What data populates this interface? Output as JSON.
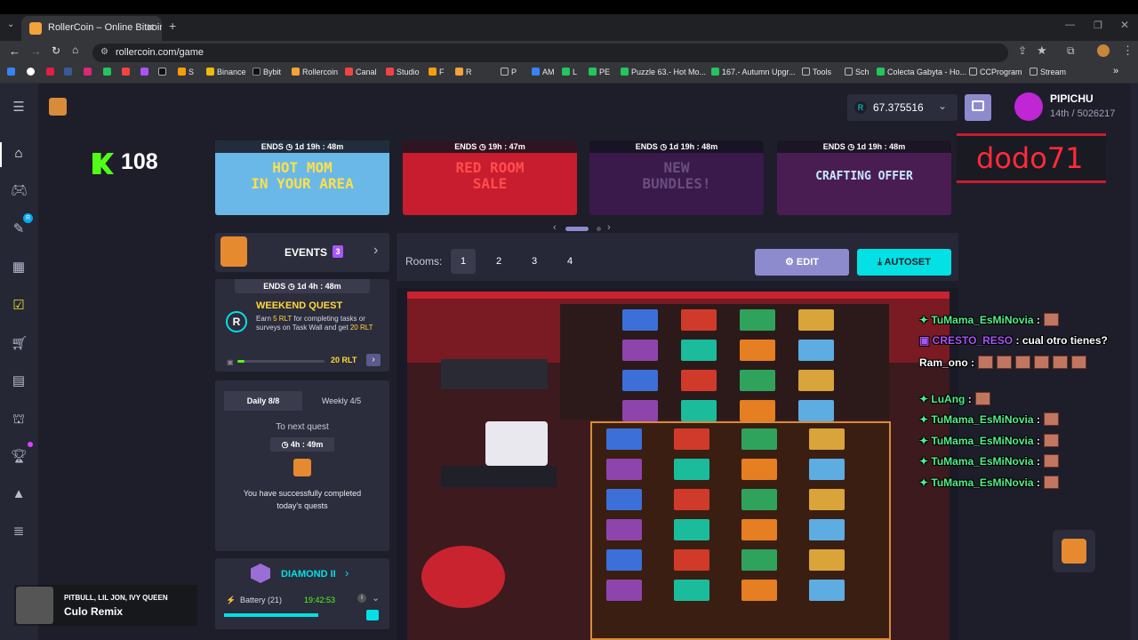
{
  "browser": {
    "tab_title": "RollerCoin – Online Bitcoin Mi",
    "tab_close": "✕",
    "new_tab": "+",
    "url": "rollercoin.com/game",
    "bookmarks": [
      "S",
      "Binance",
      "Bybit",
      "Rollercoin",
      "Canal",
      "Studio",
      "F",
      "R",
      "P",
      "AM",
      "L",
      "PE",
      "Puzzle 63.- Hot Mo...",
      "167.- Autumn Upgr...",
      "Tools",
      "Sch",
      "Colecta Gabyta - Ho...",
      "CCProgram",
      "Stream"
    ]
  },
  "header": {
    "balance": "67.375516",
    "balance_currency": "R",
    "username": "PIPICHU",
    "rank": "14th / 5026217"
  },
  "overlay": {
    "streamer_tag": "dodo71",
    "kick_count": "108"
  },
  "banners": [
    {
      "ends_label": "ENDS",
      "time": "1d 19h : 48m",
      "text": "HOT MOM\nIN YOUR AREA",
      "bg": "#6ab8e8",
      "color": "#ffdf4a"
    },
    {
      "ends_label": "ENDS",
      "time": "19h : 47m",
      "text": "RED ROOM\nSALE",
      "bg": "#c81d2e",
      "color": "#ff4d4d"
    },
    {
      "ends_label": "ENDS",
      "time": "1d 19h : 48m",
      "text": "NEW\nBUNDLES!",
      "bg": "#3a1a4a",
      "color": "#6a4d80"
    },
    {
      "ends_label": "ENDS",
      "time": "1d 19h : 48m",
      "text": "CRAFTING OFFER",
      "bg": "#4a1d52",
      "color": "#c9e9ff"
    }
  ],
  "events": {
    "title": "EVENTS",
    "count": "3",
    "ends_label": "ENDS",
    "ends_time": "1d 4h : 48m",
    "quest_title": "WEEKEND QUEST",
    "quest_desc_1": "Earn ",
    "quest_desc_rlt1": "5 RLT",
    "quest_desc_2": " for completing tasks or surveys on Task Wall and get ",
    "quest_desc_rlt2": "20 RLT",
    "quest_reward": "20 RLT",
    "progress": 0.08
  },
  "quests": {
    "tab_daily": "Daily 8/8",
    "tab_weekly": "Weekly 4/5",
    "next_label": "To next quest",
    "timer": "4h : 49m",
    "message": "You have successfully completed today's quests"
  },
  "league": {
    "title": "DIAMOND II",
    "battery_label": "Battery (21)",
    "battery_time": "19:42:53"
  },
  "rooms": {
    "label": "Rooms:",
    "numbers": [
      "1",
      "2",
      "3",
      "4"
    ],
    "active": "1",
    "edit_label": "EDIT",
    "autoset_label": "AUTOSET"
  },
  "chat": [
    {
      "user": "TuMama_EsMiNovia",
      "sep": " :",
      "msg": "",
      "emotes": 1,
      "color": "#4ff08a"
    },
    {
      "user": "CRESTO_RESO",
      "sep": " :",
      "msg": " cual otro tienes?",
      "emotes": 0,
      "color": "#a855f7"
    },
    {
      "user": "Ram_ono",
      "sep": " :",
      "msg": "",
      "emotes": 6,
      "color": "#ffffff"
    },
    {
      "user": "LuAng",
      "sep": " :",
      "msg": "",
      "emotes": 1,
      "color": "#4ff08a"
    },
    {
      "user": "TuMama_EsMiNovia",
      "sep": " :",
      "msg": "",
      "emotes": 1,
      "color": "#4ff08a"
    },
    {
      "user": "TuMama_EsMiNovia",
      "sep": " :",
      "msg": "",
      "emotes": 1,
      "color": "#4ff08a"
    },
    {
      "user": "TuMama_EsMiNovia",
      "sep": " :",
      "msg": "",
      "emotes": 1,
      "color": "#4ff08a"
    },
    {
      "user": "TuMama_EsMiNovia",
      "sep": " :",
      "msg": "",
      "emotes": 1,
      "color": "#4ff08a"
    }
  ],
  "music": {
    "artist": "PITBULL, LIL JON, IVY QUEEN",
    "song": "Culo Remix"
  },
  "colors": {
    "accent_cyan": "#03e1e4",
    "accent_purple": "#8d8bcd",
    "kick_green": "#53fc18",
    "bg": "#1d1e2a",
    "panel": "#2b2c3c"
  }
}
